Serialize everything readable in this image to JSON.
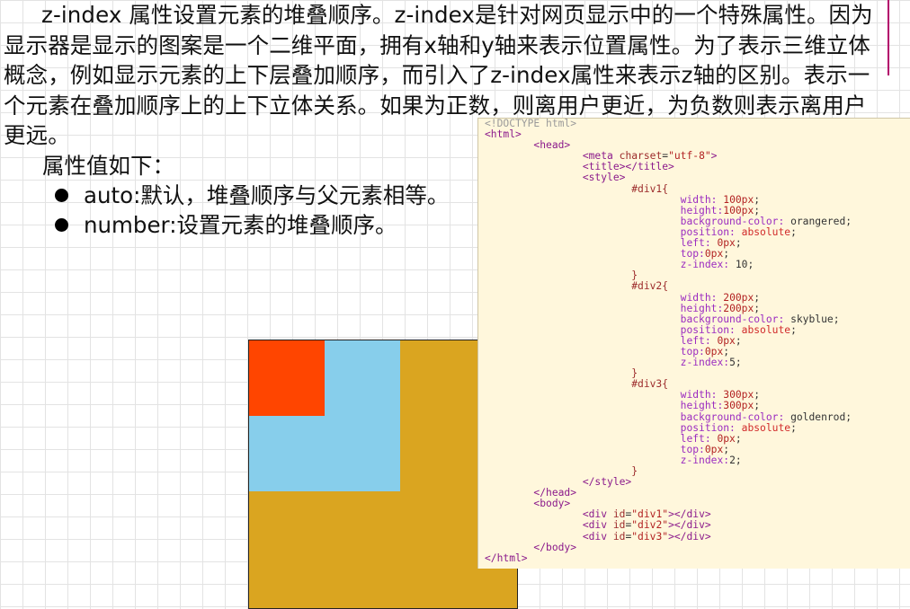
{
  "paragraph": "z-index 属性设置元素的堆叠顺序。z-index是针对网页显示中的一个特殊属性。因为显示器是显示的图案是一个二维平面，拥有x轴和y轴来表示位置属性。为了表示三维立体概念，例如显示元素的上下层叠加顺序，而引入了z-index属性来表示z轴的区别。表示一个元素在叠加顺序上的上下立体关系。如果为正数，则离用户更近，为负数则表示离用户更远。",
  "values_label": "属性值如下：",
  "bullets": [
    {
      "text": "auto:默认，堆叠顺序与父元素相等。"
    },
    {
      "text": "number:设置元素的堆叠顺序。"
    }
  ],
  "demo": {
    "boxes": [
      {
        "id": "div1",
        "color": "#ff4500",
        "z_index": 10
      },
      {
        "id": "div2",
        "color": "#87ceeb",
        "z_index": 5
      },
      {
        "id": "div3",
        "color": "#daa520",
        "z_index": 2
      }
    ]
  },
  "code": [
    [
      {
        "t": "<!DOCTYPE html>",
        "c": "doc"
      }
    ],
    [
      {
        "t": "<html>",
        "c": "tag"
      }
    ],
    [
      {
        "t": "        <head>",
        "c": "tag"
      }
    ],
    [
      {
        "t": "                <meta ",
        "c": "tag"
      },
      {
        "t": "charset",
        "c": "attr"
      },
      {
        "t": "=",
        "c": "plain"
      },
      {
        "t": "\"utf-8\"",
        "c": "str"
      },
      {
        "t": ">",
        "c": "tag"
      }
    ],
    [
      {
        "t": "                <title></title>",
        "c": "tag"
      }
    ],
    [
      {
        "t": "                <style>",
        "c": "tag"
      }
    ],
    [
      {
        "t": "                        #div1{",
        "c": "sel"
      }
    ],
    [
      {
        "t": "                                width: ",
        "c": "prop"
      },
      {
        "t": "100px",
        "c": "num"
      },
      {
        "t": ";",
        "c": "plain"
      }
    ],
    [
      {
        "t": "                                height:",
        "c": "prop"
      },
      {
        "t": "100px",
        "c": "num"
      },
      {
        "t": ";",
        "c": "plain"
      }
    ],
    [
      {
        "t": "                                background-color: ",
        "c": "prop"
      },
      {
        "t": "orangered",
        "c": "plain"
      },
      {
        "t": ";",
        "c": "plain"
      }
    ],
    [
      {
        "t": "                                position: ",
        "c": "prop"
      },
      {
        "t": "absolute",
        "c": "kw"
      },
      {
        "t": ";",
        "c": "plain"
      }
    ],
    [
      {
        "t": "                                left: ",
        "c": "prop"
      },
      {
        "t": "0px",
        "c": "num"
      },
      {
        "t": ";",
        "c": "plain"
      }
    ],
    [
      {
        "t": "                                top:",
        "c": "prop"
      },
      {
        "t": "0px",
        "c": "num"
      },
      {
        "t": ";",
        "c": "plain"
      }
    ],
    [
      {
        "t": "                                z-index: ",
        "c": "prop"
      },
      {
        "t": "10",
        "c": "plain"
      },
      {
        "t": ";",
        "c": "plain"
      }
    ],
    [
      {
        "t": "                        }",
        "c": "sel"
      }
    ],
    [
      {
        "t": "                        #div2{",
        "c": "sel"
      }
    ],
    [
      {
        "t": "                                width: ",
        "c": "prop"
      },
      {
        "t": "200px",
        "c": "num"
      },
      {
        "t": ";",
        "c": "plain"
      }
    ],
    [
      {
        "t": "                                height:",
        "c": "prop"
      },
      {
        "t": "200px",
        "c": "num"
      },
      {
        "t": ";",
        "c": "plain"
      }
    ],
    [
      {
        "t": "                                background-color: ",
        "c": "prop"
      },
      {
        "t": "skyblue",
        "c": "plain"
      },
      {
        "t": ";",
        "c": "plain"
      }
    ],
    [
      {
        "t": "                                position: ",
        "c": "prop"
      },
      {
        "t": "absolute",
        "c": "kw"
      },
      {
        "t": ";",
        "c": "plain"
      }
    ],
    [
      {
        "t": "                                left: ",
        "c": "prop"
      },
      {
        "t": "0px",
        "c": "num"
      },
      {
        "t": ";",
        "c": "plain"
      }
    ],
    [
      {
        "t": "                                top:",
        "c": "prop"
      },
      {
        "t": "0px",
        "c": "num"
      },
      {
        "t": ";",
        "c": "plain"
      }
    ],
    [
      {
        "t": "                                z-index:",
        "c": "prop"
      },
      {
        "t": "5",
        "c": "plain"
      },
      {
        "t": ";",
        "c": "plain"
      }
    ],
    [
      {
        "t": "                        }",
        "c": "sel"
      }
    ],
    [
      {
        "t": "                        #div3{",
        "c": "sel"
      }
    ],
    [
      {
        "t": "                                width: ",
        "c": "prop"
      },
      {
        "t": "300px",
        "c": "num"
      },
      {
        "t": ";",
        "c": "plain"
      }
    ],
    [
      {
        "t": "                                height:",
        "c": "prop"
      },
      {
        "t": "300px",
        "c": "num"
      },
      {
        "t": ";",
        "c": "plain"
      }
    ],
    [
      {
        "t": "                                background-color: ",
        "c": "prop"
      },
      {
        "t": "goldenrod",
        "c": "plain"
      },
      {
        "t": ";",
        "c": "plain"
      }
    ],
    [
      {
        "t": "                                position: ",
        "c": "prop"
      },
      {
        "t": "absolute",
        "c": "kw"
      },
      {
        "t": ";",
        "c": "plain"
      }
    ],
    [
      {
        "t": "                                left: ",
        "c": "prop"
      },
      {
        "t": "0px",
        "c": "num"
      },
      {
        "t": ";",
        "c": "plain"
      }
    ],
    [
      {
        "t": "                                top:",
        "c": "prop"
      },
      {
        "t": "0px",
        "c": "num"
      },
      {
        "t": ";",
        "c": "plain"
      }
    ],
    [
      {
        "t": "                                z-index:",
        "c": "prop"
      },
      {
        "t": "2",
        "c": "plain"
      },
      {
        "t": ";",
        "c": "plain"
      }
    ],
    [
      {
        "t": "                        }",
        "c": "sel"
      }
    ],
    [
      {
        "t": "                </style>",
        "c": "tag"
      }
    ],
    [
      {
        "t": "        </head>",
        "c": "tag"
      }
    ],
    [
      {
        "t": "        <body>",
        "c": "tag"
      }
    ],
    [
      {
        "t": "                <div ",
        "c": "tag"
      },
      {
        "t": "id",
        "c": "attr"
      },
      {
        "t": "=",
        "c": "plain"
      },
      {
        "t": "\"div1\"",
        "c": "str"
      },
      {
        "t": "></div>",
        "c": "tag"
      }
    ],
    [
      {
        "t": "                <div ",
        "c": "tag"
      },
      {
        "t": "id",
        "c": "attr"
      },
      {
        "t": "=",
        "c": "plain"
      },
      {
        "t": "\"div2\"",
        "c": "str"
      },
      {
        "t": "></div>",
        "c": "tag"
      }
    ],
    [
      {
        "t": "                <div ",
        "c": "tag"
      },
      {
        "t": "id",
        "c": "attr"
      },
      {
        "t": "=",
        "c": "plain"
      },
      {
        "t": "\"div3\"",
        "c": "str"
      },
      {
        "t": "></div>",
        "c": "tag"
      }
    ],
    [
      {
        "t": "        </body>",
        "c": "tag"
      }
    ],
    [
      {
        "t": "</html>",
        "c": "tag"
      }
    ]
  ]
}
